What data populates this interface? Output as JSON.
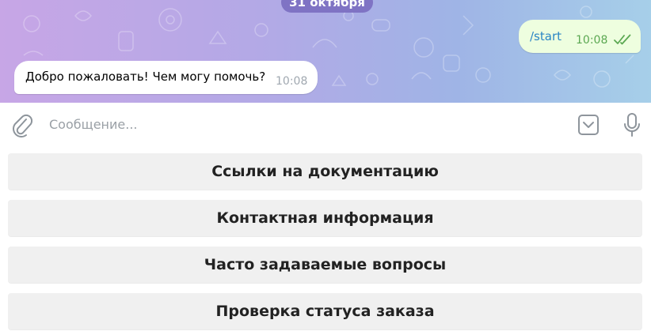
{
  "chat": {
    "date_label": "31 октября",
    "messages": [
      {
        "direction": "outgoing",
        "text": "/start",
        "time": "10:08",
        "status": "read"
      },
      {
        "direction": "incoming",
        "text": "Добро пожаловать! Чем могу помочь?",
        "time": "10:08"
      }
    ]
  },
  "composer": {
    "placeholder": "Сообщение...",
    "icons": {
      "attach": "paperclip-icon",
      "keyboard": "keyboard-toggle-icon",
      "mic": "microphone-icon"
    }
  },
  "keyboard": {
    "buttons": [
      {
        "label": "Ссылки на документацию"
      },
      {
        "label": "Контактная информация"
      },
      {
        "label": "Часто задаваемые вопросы"
      },
      {
        "label": "Проверка статуса заказа"
      }
    ]
  },
  "colors": {
    "accent_link": "#2b86c5",
    "outgoing_bubble": "#eefedf",
    "check_green": "#5ba852",
    "date_pill": "#7f73c4",
    "button_bg": "#f0f0f0"
  }
}
